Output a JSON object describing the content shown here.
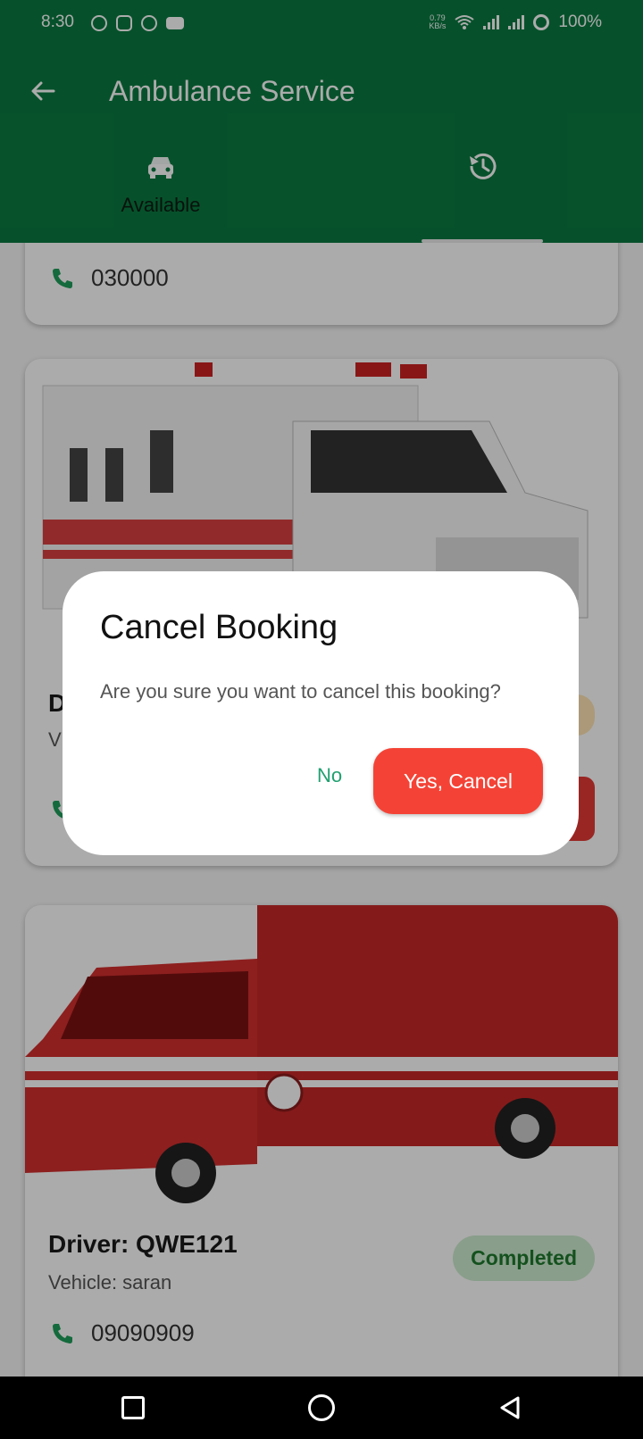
{
  "status_bar": {
    "time": "8:30",
    "net_speed_top": "0.79",
    "net_speed_unit": "KB/s",
    "battery": "100%"
  },
  "app_bar": {
    "title": "Ambulance Service",
    "tabs": [
      {
        "label": "Available",
        "icon": "taxi-icon"
      },
      {
        "label": "",
        "icon": "history-icon"
      }
    ]
  },
  "bookings": [
    {
      "phone": "030000"
    },
    {
      "driver": "D",
      "vehicle": "V",
      "status": ""
    },
    {
      "driver": "Driver: QWE121",
      "vehicle": "Vehicle: saran",
      "status": "Completed",
      "phone": "09090909"
    }
  ],
  "dialog": {
    "title": "Cancel Booking",
    "message": "Are you sure you want to cancel this booking?",
    "no_label": "No",
    "yes_label": "Yes, Cancel"
  },
  "colors": {
    "primary": "#0a7a40",
    "danger": "#f44336",
    "accent_text": "#20a070"
  }
}
